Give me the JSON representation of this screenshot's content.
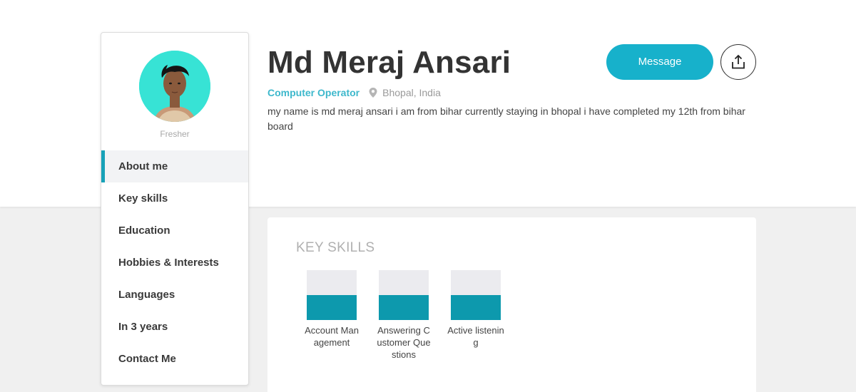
{
  "profile": {
    "name": "Md Meraj Ansari",
    "job_title": "Computer Operator",
    "location": "Bhopal, India",
    "bio": "my name is md meraj ansari i am from bihar currently staying in bhopal i have completed my 12th from bihar board",
    "level": "Fresher"
  },
  "actions": {
    "message_label": "Message",
    "share_icon": "share-upload-icon"
  },
  "sidebar": {
    "items": [
      {
        "label": "About me",
        "active": true
      },
      {
        "label": "Key skills",
        "active": false
      },
      {
        "label": "Education",
        "active": false
      },
      {
        "label": "Hobbies & Interests",
        "active": false
      },
      {
        "label": "Languages",
        "active": false
      },
      {
        "label": "In 3 years",
        "active": false
      },
      {
        "label": "Contact Me",
        "active": false
      }
    ]
  },
  "skills": {
    "title": "KEY SKILLS",
    "items": [
      {
        "label": "Account Management",
        "level": 0.5
      },
      {
        "label": "Answering Customer Questions",
        "level": 0.5
      },
      {
        "label": "Active listening",
        "level": 0.5
      }
    ]
  },
  "colors": {
    "accent": "#17b1cb",
    "skill_fill": "#0d99ad",
    "avatar_bg": "#37e3d5"
  }
}
